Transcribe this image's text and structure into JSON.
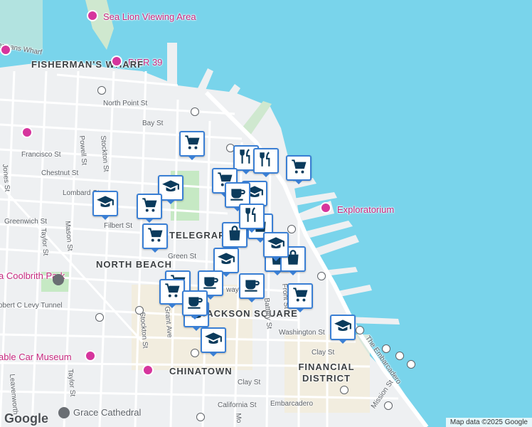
{
  "map": {
    "neighborhoods": [
      "FISHERMAN'S WHARF",
      "TELEGRAPH H",
      "NORTH BEACH",
      "JACKSON SQUARE",
      "FINANCIAL DISTRICT",
      "CHINATOWN"
    ],
    "pois": [
      "Sea Lion Viewing Area",
      "PIER 39",
      "Exploratorium",
      "a Coolbrith Park",
      "able Car Museum",
      "Grace Cathedral"
    ],
    "streets": [
      "ermans Wharf",
      "North Point St",
      "Bay St",
      "Francisco St",
      "Chestnut St",
      "Lombard St",
      "Greenwich St",
      "Filbert St",
      "Green St",
      "Washington St",
      "Clay St",
      "Clay St",
      "California St",
      "Embarcadero",
      "The Embarcadero",
      "obert C Levy Tunnel",
      "Stockton St",
      "Powell St",
      "Mason St",
      "Taylor St",
      "Jones St",
      "Grant Ave",
      "Stockton St",
      "Taylor St",
      "Leavenworth",
      "Battery St",
      "Front St",
      "Mo",
      "Mission St",
      "way"
    ],
    "markers": [
      "shopping-cart-icon",
      "restaurant-icon",
      "restaurant-icon",
      "shopping-cart-icon",
      "school-icon",
      "school-icon",
      "shopping-cart-icon",
      "shopping-cart-icon",
      "shopping-cart-icon",
      "school-icon",
      "coffee-icon",
      "shopping-bag-icon",
      "shopping-bag-icon",
      "restaurant-icon",
      "shopping-bag-icon",
      "shopping-bag-icon",
      "school-icon",
      "coffee-icon",
      "shopping-cart-icon",
      "coffee-icon",
      "school-icon",
      "shopping-cart-icon",
      "school-icon",
      "shopping-cart-icon",
      "coffee-icon",
      "school-icon",
      "school-icon"
    ],
    "colors": {
      "water": "#79d4eb",
      "land": "#eef0f2",
      "park": "#c6e9c4",
      "marker_border": "#3a7fd4",
      "marker_icon": "#0b3b5c",
      "poi": "#c5277e"
    }
  },
  "footer": {
    "logo": "Google",
    "attribution": "Map data ©2025 Google"
  }
}
